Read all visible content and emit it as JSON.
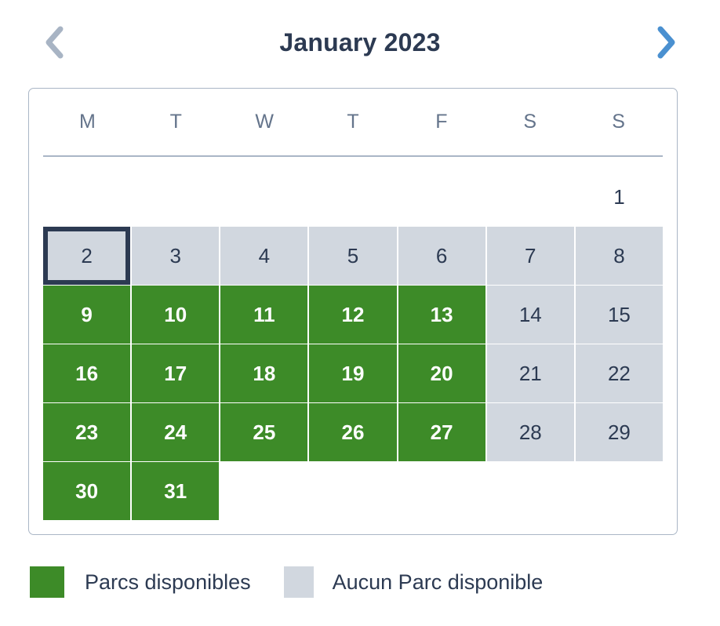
{
  "header": {
    "title": "January 2023",
    "prev_icon": "chevron-left-icon",
    "next_icon": "chevron-right-icon",
    "prev_enabled": false,
    "next_enabled": true,
    "prev_color": "#a8b4c4",
    "next_color": "#4a90d0",
    "title_color": "#2c3a52"
  },
  "calendar": {
    "weekdays": [
      "M",
      "T",
      "W",
      "T",
      "F",
      "S",
      "S"
    ],
    "selected_day": 2,
    "colors": {
      "available": "#3d8b28",
      "unavailable": "#d1d7df",
      "selected_border": "#2c3a52",
      "card_border": "#aab6c6",
      "weekday_text": "#64748b",
      "day_text": "#2c3a52",
      "available_text": "#ffffff"
    },
    "weeks": [
      [
        {
          "label": "",
          "state": "empty"
        },
        {
          "label": "",
          "state": "empty"
        },
        {
          "label": "",
          "state": "empty"
        },
        {
          "label": "",
          "state": "empty"
        },
        {
          "label": "",
          "state": "empty"
        },
        {
          "label": "",
          "state": "empty"
        },
        {
          "label": "1",
          "state": "plain"
        }
      ],
      [
        {
          "label": "2",
          "state": "unavailable",
          "selected": true
        },
        {
          "label": "3",
          "state": "unavailable"
        },
        {
          "label": "4",
          "state": "unavailable"
        },
        {
          "label": "5",
          "state": "unavailable"
        },
        {
          "label": "6",
          "state": "unavailable"
        },
        {
          "label": "7",
          "state": "unavailable"
        },
        {
          "label": "8",
          "state": "unavailable"
        }
      ],
      [
        {
          "label": "9",
          "state": "available"
        },
        {
          "label": "10",
          "state": "available"
        },
        {
          "label": "11",
          "state": "available"
        },
        {
          "label": "12",
          "state": "available"
        },
        {
          "label": "13",
          "state": "available"
        },
        {
          "label": "14",
          "state": "unavailable"
        },
        {
          "label": "15",
          "state": "unavailable"
        }
      ],
      [
        {
          "label": "16",
          "state": "available"
        },
        {
          "label": "17",
          "state": "available"
        },
        {
          "label": "18",
          "state": "available"
        },
        {
          "label": "19",
          "state": "available"
        },
        {
          "label": "20",
          "state": "available"
        },
        {
          "label": "21",
          "state": "unavailable"
        },
        {
          "label": "22",
          "state": "unavailable"
        }
      ],
      [
        {
          "label": "23",
          "state": "available"
        },
        {
          "label": "24",
          "state": "available"
        },
        {
          "label": "25",
          "state": "available"
        },
        {
          "label": "26",
          "state": "available"
        },
        {
          "label": "27",
          "state": "available"
        },
        {
          "label": "28",
          "state": "unavailable"
        },
        {
          "label": "29",
          "state": "unavailable"
        }
      ],
      [
        {
          "label": "30",
          "state": "available"
        },
        {
          "label": "31",
          "state": "available"
        },
        {
          "label": "",
          "state": "empty"
        },
        {
          "label": "",
          "state": "empty"
        },
        {
          "label": "",
          "state": "empty"
        },
        {
          "label": "",
          "state": "empty"
        },
        {
          "label": "",
          "state": "empty"
        }
      ]
    ]
  },
  "legend": {
    "items": [
      {
        "label": "Parcs disponibles",
        "color": "#3d8b28",
        "swatch": "green"
      },
      {
        "label": "Aucun Parc disponible",
        "color": "#d1d7df",
        "swatch": "grey"
      }
    ]
  }
}
